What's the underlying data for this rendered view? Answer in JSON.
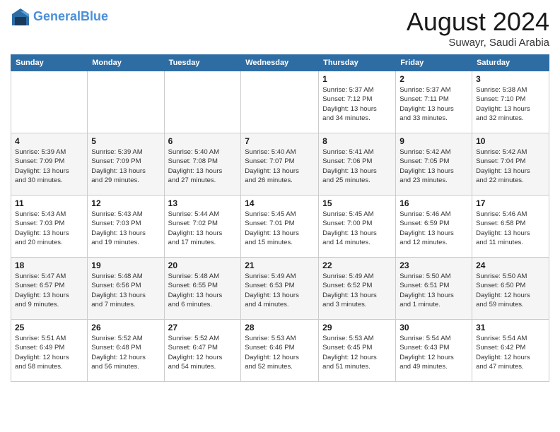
{
  "logo": {
    "line1": "General",
    "line2": "Blue"
  },
  "title": "August 2024",
  "subtitle": "Suwayr, Saudi Arabia",
  "weekdays": [
    "Sunday",
    "Monday",
    "Tuesday",
    "Wednesday",
    "Thursday",
    "Friday",
    "Saturday"
  ],
  "weeks": [
    [
      {
        "day": "",
        "info": ""
      },
      {
        "day": "",
        "info": ""
      },
      {
        "day": "",
        "info": ""
      },
      {
        "day": "",
        "info": ""
      },
      {
        "day": "1",
        "info": "Sunrise: 5:37 AM\nSunset: 7:12 PM\nDaylight: 13 hours\nand 34 minutes."
      },
      {
        "day": "2",
        "info": "Sunrise: 5:37 AM\nSunset: 7:11 PM\nDaylight: 13 hours\nand 33 minutes."
      },
      {
        "day": "3",
        "info": "Sunrise: 5:38 AM\nSunset: 7:10 PM\nDaylight: 13 hours\nand 32 minutes."
      }
    ],
    [
      {
        "day": "4",
        "info": "Sunrise: 5:39 AM\nSunset: 7:09 PM\nDaylight: 13 hours\nand 30 minutes."
      },
      {
        "day": "5",
        "info": "Sunrise: 5:39 AM\nSunset: 7:09 PM\nDaylight: 13 hours\nand 29 minutes."
      },
      {
        "day": "6",
        "info": "Sunrise: 5:40 AM\nSunset: 7:08 PM\nDaylight: 13 hours\nand 27 minutes."
      },
      {
        "day": "7",
        "info": "Sunrise: 5:40 AM\nSunset: 7:07 PM\nDaylight: 13 hours\nand 26 minutes."
      },
      {
        "day": "8",
        "info": "Sunrise: 5:41 AM\nSunset: 7:06 PM\nDaylight: 13 hours\nand 25 minutes."
      },
      {
        "day": "9",
        "info": "Sunrise: 5:42 AM\nSunset: 7:05 PM\nDaylight: 13 hours\nand 23 minutes."
      },
      {
        "day": "10",
        "info": "Sunrise: 5:42 AM\nSunset: 7:04 PM\nDaylight: 13 hours\nand 22 minutes."
      }
    ],
    [
      {
        "day": "11",
        "info": "Sunrise: 5:43 AM\nSunset: 7:03 PM\nDaylight: 13 hours\nand 20 minutes."
      },
      {
        "day": "12",
        "info": "Sunrise: 5:43 AM\nSunset: 7:03 PM\nDaylight: 13 hours\nand 19 minutes."
      },
      {
        "day": "13",
        "info": "Sunrise: 5:44 AM\nSunset: 7:02 PM\nDaylight: 13 hours\nand 17 minutes."
      },
      {
        "day": "14",
        "info": "Sunrise: 5:45 AM\nSunset: 7:01 PM\nDaylight: 13 hours\nand 15 minutes."
      },
      {
        "day": "15",
        "info": "Sunrise: 5:45 AM\nSunset: 7:00 PM\nDaylight: 13 hours\nand 14 minutes."
      },
      {
        "day": "16",
        "info": "Sunrise: 5:46 AM\nSunset: 6:59 PM\nDaylight: 13 hours\nand 12 minutes."
      },
      {
        "day": "17",
        "info": "Sunrise: 5:46 AM\nSunset: 6:58 PM\nDaylight: 13 hours\nand 11 minutes."
      }
    ],
    [
      {
        "day": "18",
        "info": "Sunrise: 5:47 AM\nSunset: 6:57 PM\nDaylight: 13 hours\nand 9 minutes."
      },
      {
        "day": "19",
        "info": "Sunrise: 5:48 AM\nSunset: 6:56 PM\nDaylight: 13 hours\nand 7 minutes."
      },
      {
        "day": "20",
        "info": "Sunrise: 5:48 AM\nSunset: 6:55 PM\nDaylight: 13 hours\nand 6 minutes."
      },
      {
        "day": "21",
        "info": "Sunrise: 5:49 AM\nSunset: 6:53 PM\nDaylight: 13 hours\nand 4 minutes."
      },
      {
        "day": "22",
        "info": "Sunrise: 5:49 AM\nSunset: 6:52 PM\nDaylight: 13 hours\nand 3 minutes."
      },
      {
        "day": "23",
        "info": "Sunrise: 5:50 AM\nSunset: 6:51 PM\nDaylight: 13 hours\nand 1 minute."
      },
      {
        "day": "24",
        "info": "Sunrise: 5:50 AM\nSunset: 6:50 PM\nDaylight: 12 hours\nand 59 minutes."
      }
    ],
    [
      {
        "day": "25",
        "info": "Sunrise: 5:51 AM\nSunset: 6:49 PM\nDaylight: 12 hours\nand 58 minutes."
      },
      {
        "day": "26",
        "info": "Sunrise: 5:52 AM\nSunset: 6:48 PM\nDaylight: 12 hours\nand 56 minutes."
      },
      {
        "day": "27",
        "info": "Sunrise: 5:52 AM\nSunset: 6:47 PM\nDaylight: 12 hours\nand 54 minutes."
      },
      {
        "day": "28",
        "info": "Sunrise: 5:53 AM\nSunset: 6:46 PM\nDaylight: 12 hours\nand 52 minutes."
      },
      {
        "day": "29",
        "info": "Sunrise: 5:53 AM\nSunset: 6:45 PM\nDaylight: 12 hours\nand 51 minutes."
      },
      {
        "day": "30",
        "info": "Sunrise: 5:54 AM\nSunset: 6:43 PM\nDaylight: 12 hours\nand 49 minutes."
      },
      {
        "day": "31",
        "info": "Sunrise: 5:54 AM\nSunset: 6:42 PM\nDaylight: 12 hours\nand 47 minutes."
      }
    ]
  ]
}
